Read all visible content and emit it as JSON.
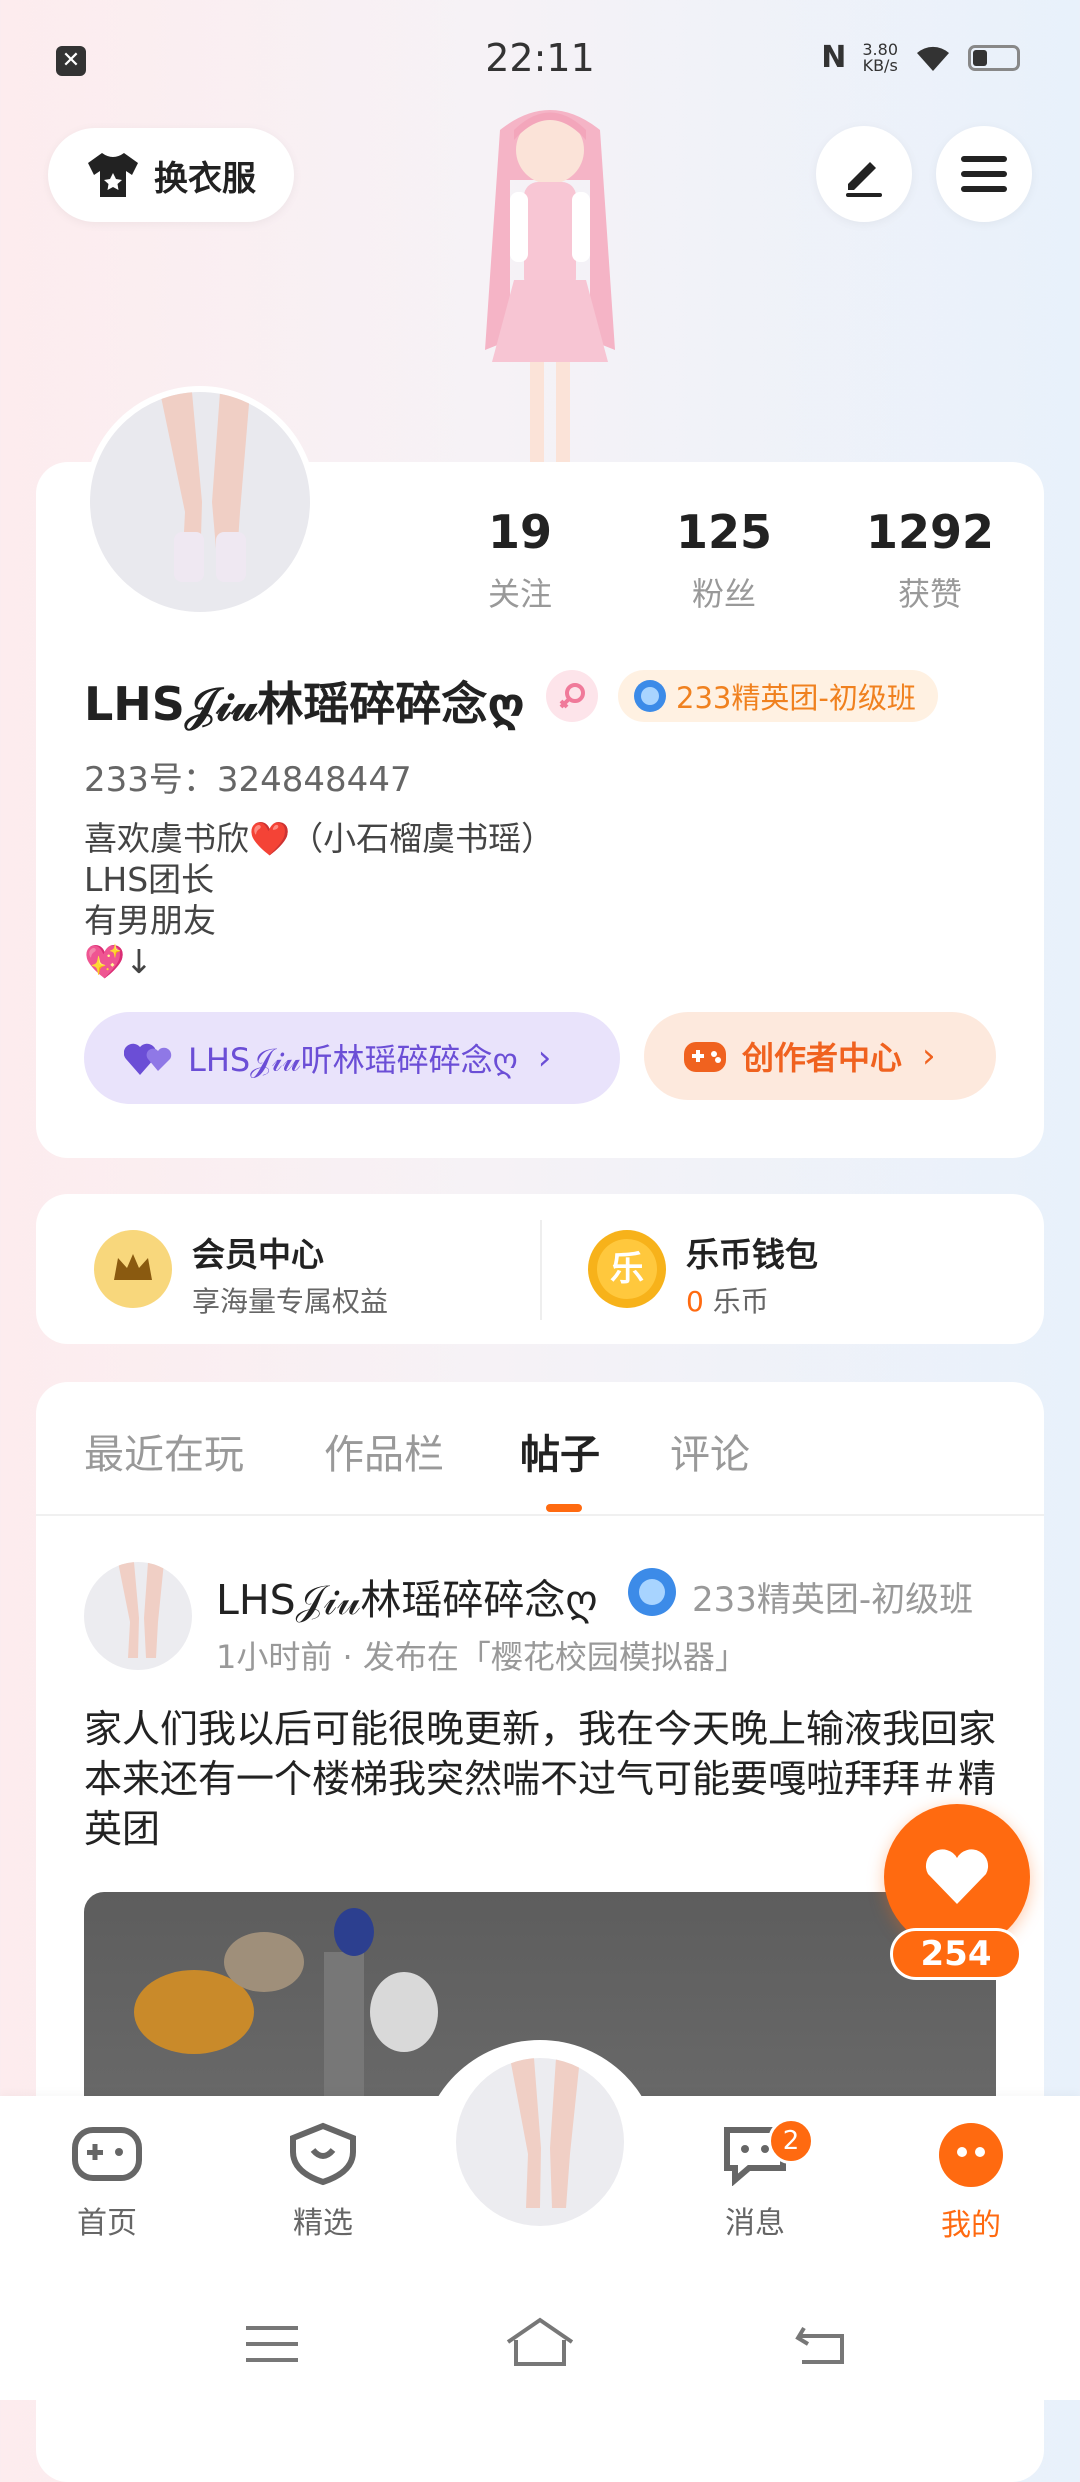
{
  "status_bar": {
    "time": "22:11",
    "net_speed": "3.80",
    "net_unit": "KB/s"
  },
  "top": {
    "outfit_label": "换衣服"
  },
  "profile": {
    "stats": [
      {
        "value": "19",
        "label": "关注"
      },
      {
        "value": "125",
        "label": "粉丝"
      },
      {
        "value": "1292",
        "label": "获赞"
      }
    ],
    "username": "LHS𝒥𝒾𝓊林瑶碎碎念ღ",
    "level_badge": "233精英团-初级班",
    "uid": "233号：324848447",
    "bio": [
      "喜欢虞书欣❤️（小石榴虞书瑶）",
      "LHS团长",
      "有男朋友",
      "💖↓"
    ],
    "fan_club_label": "LHS𝒥𝒾𝓊听林瑶碎碎念ღ",
    "creator_label": "创作者中心"
  },
  "member": {
    "vip_title": "会员中心",
    "vip_sub": "享海量专属权益",
    "wallet_title": "乐币钱包",
    "wallet_amount": "0",
    "wallet_unit": "乐币",
    "coin_char": "乐"
  },
  "tabs": [
    {
      "label": "最近在玩"
    },
    {
      "label": "作品栏"
    },
    {
      "label": "帖子"
    },
    {
      "label": "评论"
    }
  ],
  "post": {
    "author": "LHS𝒥𝒾𝓊林瑶碎碎念ღ",
    "badge": "233精英团-初级班",
    "meta": "1小时前 · 发布在「樱花校园模拟器」",
    "text": "家人们我以后可能很晚更新，我在今天晚上输液我回家本来还有一个楼梯我突然喘不过气可能要嘎啦拜拜＃精英团",
    "likes": "254"
  },
  "nav": [
    {
      "label": "首页"
    },
    {
      "label": "精选"
    },
    {
      "label": "消息",
      "badge": "2"
    },
    {
      "label": "我的"
    }
  ],
  "colors": {
    "accent": "#ff6a10",
    "purple": "#6b4ed6",
    "gold": "#f0811f"
  }
}
